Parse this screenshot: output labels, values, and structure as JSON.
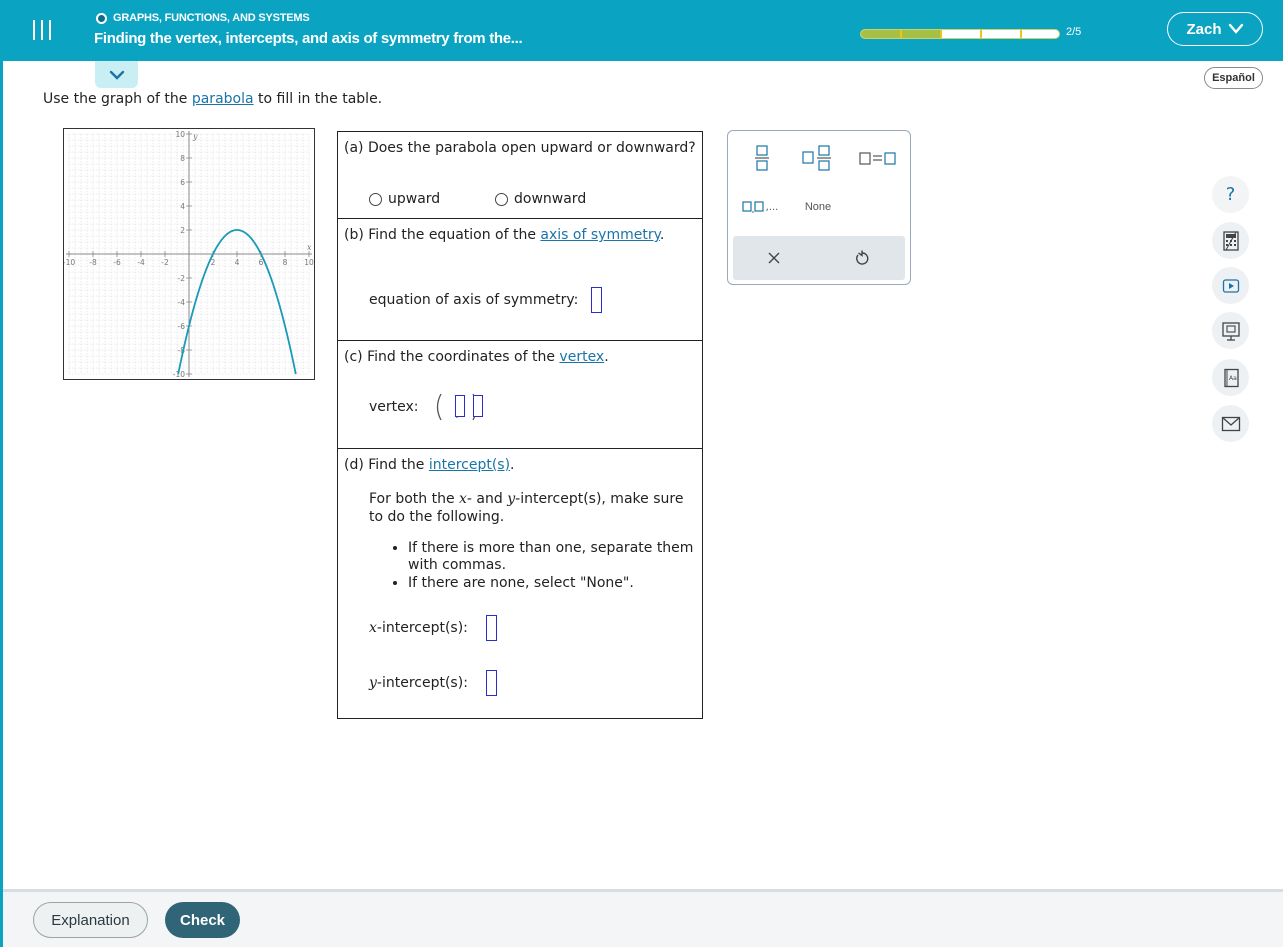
{
  "header": {
    "topic": "GRAPHS, FUNCTIONS, AND SYSTEMS",
    "title": "Finding the vertex, intercepts, and axis of symmetry from the...",
    "progress_text": "2/5",
    "progress_fraction": 0.4,
    "user_name": "Zach",
    "colors": {
      "bar": "#0aa3c2",
      "progress": "#a7c043"
    }
  },
  "language_button": "Español",
  "instruction": {
    "before": "Use the graph of the ",
    "link": "parabola",
    "after": " to fill in the table."
  },
  "graph": {
    "x_range": [
      -10,
      10
    ],
    "y_range": [
      -10,
      10
    ],
    "x_ticks": [
      "-10",
      "-8",
      "-6",
      "-4",
      "-2",
      "2",
      "4",
      "6",
      "8",
      "10"
    ],
    "y_ticks": [
      "10",
      "8",
      "6",
      "4",
      "2",
      "-2",
      "-4",
      "-6",
      "-8",
      "-10"
    ],
    "x_axis_label": "x",
    "y_axis_label": "y",
    "vertex": [
      4,
      2
    ],
    "a": -0.5,
    "curve_color": "#1a9ab5"
  },
  "questions": {
    "a": {
      "label": "(a) Does the parabola open upward or downward?",
      "option_up": "upward",
      "option_down": "downward"
    },
    "b": {
      "before": "(b) Find the equation of the ",
      "link": "axis of symmetry",
      "after": ".",
      "field_label": "equation of axis of symmetry:"
    },
    "c": {
      "before": "(c) Find the coordinates of the ",
      "link": "vertex",
      "after": ".",
      "field_label": "vertex:"
    },
    "d": {
      "before": "(d) Find the ",
      "link": "intercept(s)",
      "after": ".",
      "instr_1": "For both the ",
      "instr_x": "x",
      "instr_2": "- and ",
      "instr_y": "y",
      "instr_3": "-intercept(s), make sure to do the following.",
      "bullet_1": "If there is more than one, separate them with commas.",
      "bullet_2": "If there are none, select \"None\".",
      "x_var": "x",
      "x_label": "-intercept(s):",
      "y_var": "y",
      "y_label": "-intercept(s):"
    }
  },
  "palette": {
    "none_label": "None",
    "list_suffix": ",..."
  },
  "footer": {
    "explanation": "Explanation",
    "check": "Check"
  }
}
